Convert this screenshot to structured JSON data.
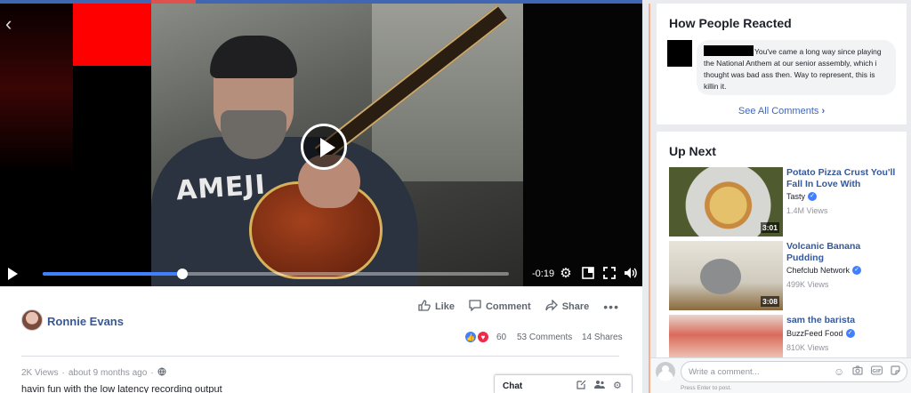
{
  "video": {
    "time_remaining": "-0:19",
    "progress_fraction": 0.3,
    "shirt_text": "AMEJI"
  },
  "post": {
    "author": "Ronnie Evans",
    "actions": {
      "like": "Like",
      "comment": "Comment",
      "share": "Share"
    },
    "reaction_count": "60",
    "comments_count": "53 Comments",
    "shares_count": "14 Shares",
    "views": "2K Views",
    "separator": "·",
    "time_ago": "about 9 months ago",
    "description": "havin fun with the low latency recording output"
  },
  "chat": {
    "label": "Chat"
  },
  "sidebar": {
    "reactions_title": "How People Reacted",
    "top_comment": "You've came a long way since playing the National Anthem at our senior assembly, which i thought was bad ass then. Way to represent, this is killin it.",
    "see_all": "See All Comments",
    "up_next_title": "Up Next",
    "videos": [
      {
        "title": "Potato Pizza Crust You'll Fall In Love With",
        "channel": "Tasty",
        "views": "1.4M Views",
        "duration": "3:01"
      },
      {
        "title": "Volcanic Banana Pudding",
        "channel": "Chefclub Network",
        "views": "499K Views",
        "duration": "3:08"
      },
      {
        "title": "sam the barista",
        "channel": "BuzzFeed Food",
        "views": "810K Views",
        "duration": ""
      }
    ]
  },
  "comment_box": {
    "placeholder": "Write a comment...",
    "hint": "Press Enter to post."
  },
  "colors": {
    "facebook_blue": "#4267b2",
    "link_blue": "#365899",
    "progress_blue": "#4080ff",
    "accent_orange": "#f6b08f"
  }
}
